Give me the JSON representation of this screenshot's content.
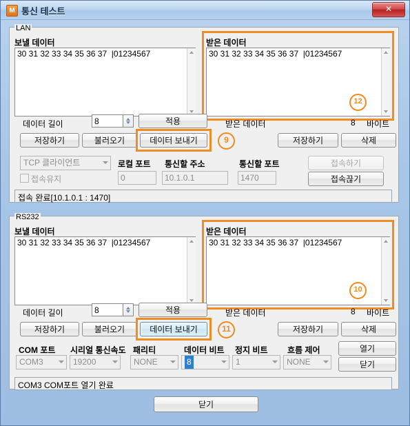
{
  "window": {
    "title": "통신 테스트",
    "icon_letter": "M",
    "close_label": "✕",
    "accent_color": "#ef8c22",
    "titlebar_close_color": "#b72020"
  },
  "lan": {
    "group_label": "LAN",
    "send_label": "보낼 데이터",
    "send_value": "30 31 32 33 34 35 36 37  |01234567",
    "recv_label": "받은 데이터",
    "recv_value": "30 31 32 33 34 35 36 37  |01234567",
    "length_label": "데이터 길이",
    "length_value": "8",
    "apply_label": "적용",
    "recv_count_label": "받은 데이터",
    "recv_count_value": "8",
    "recv_unit": "바이트",
    "save_label": "저장하기",
    "load_label": "불러오기",
    "send_button_label": "데이터 보내기",
    "recv_save_label": "저장하기",
    "recv_delete_label": "삭제",
    "mode_value": "TCP 클라이언트",
    "keepalive_label": "접속유지",
    "local_port_label": "로컬 포트",
    "local_port_value": "0",
    "address_label": "통신할 주소",
    "address_value": "10.1.0.1",
    "port_label": "통신할 포트",
    "port_value": "1470",
    "connect_label": "접속하기",
    "disconnect_label": "접속끊기",
    "status_text": "접속 완료[10.1.0.1 : 1470]"
  },
  "rs232": {
    "group_label": "RS232",
    "send_label": "보낼 데이터",
    "send_value": "30 31 32 33 34 35 36 37  |01234567",
    "recv_label": "받은 데이터",
    "recv_value": "30 31 32 33 34 35 36 37  |01234567",
    "length_label": "데이터 길이",
    "length_value": "8",
    "apply_label": "적용",
    "recv_count_label": "받은 데이터",
    "recv_count_value": "8",
    "recv_unit": "바이트",
    "save_label": "저장하기",
    "load_label": "불러오기",
    "send_button_label": "데이터 보내기",
    "recv_save_label": "저장하기",
    "recv_delete_label": "삭제",
    "com_port_label": "COM 포트",
    "com_port_value": "COM3",
    "baud_label": "시리얼 통신속도",
    "baud_value": "19200",
    "parity_label": "패리티",
    "parity_value": "NONE",
    "databits_label": "데이터 비트",
    "databits_value": "8",
    "stopbits_label": "정지 비트",
    "stopbits_value": "1",
    "flow_label": "흐름 제어",
    "flow_value": "NONE",
    "open_label": "열기",
    "close_label": "닫기",
    "status_text": "COM3 COM포트 열기 완료"
  },
  "footer": {
    "close_label": "닫기"
  },
  "annotations": {
    "step9": "9",
    "step10": "10",
    "step11": "11",
    "step12": "12"
  }
}
